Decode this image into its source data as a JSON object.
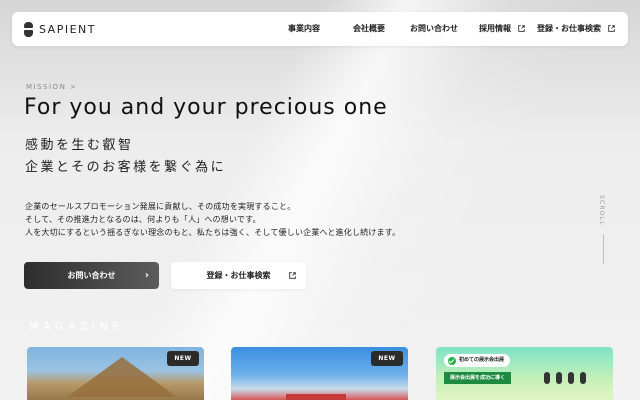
{
  "header": {
    "logo_text": "SAPIENT",
    "nav": [
      {
        "label": "事業内容"
      },
      {
        "label": "会社概要"
      },
      {
        "label": "お問い合わせ"
      },
      {
        "label": "採用情報"
      },
      {
        "label": "登録・お仕事検索"
      }
    ]
  },
  "hero": {
    "mission_label": "MISSION >",
    "title": "For you and your precious one",
    "subtitle_line1": "感動を生む叡智",
    "subtitle_line2": "企業とそのお客様を繋ぐ為に",
    "body_line1": "企業のセールスプロモーション発展に貢献し、その成功を実現すること。",
    "body_line2": "そして、その推進力となるのは、何よりも「人」への想いです。",
    "body_line3": "人を大切にするという揺るぎない理念のもと、私たちは強く、そして優しい企業へと進化し続けます。"
  },
  "buttons": {
    "contact_label": "お問い合わせ",
    "register_label": "登録・お仕事検索"
  },
  "scroll_label": "SCROLL",
  "magazine": {
    "heading": "MAGAZINE",
    "cards": [
      {
        "badge": "NEW"
      },
      {
        "badge": "NEW"
      },
      {
        "tag": "初めての展示会出展",
        "banner": "展示会出展を成功に導く"
      }
    ]
  },
  "colors": {
    "accent_dark": "#2d2d2d",
    "green": "#1d8a3f"
  },
  "icons": [
    "external-link-icon",
    "chevron-right-icon",
    "check-circle-icon"
  ]
}
